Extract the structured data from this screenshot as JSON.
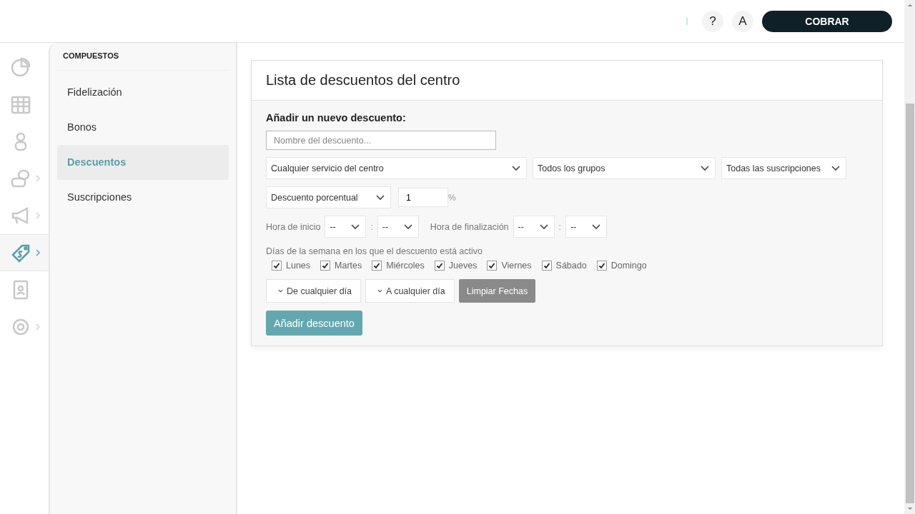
{
  "header": {
    "help": "?",
    "avatar": "A",
    "charge_button": "COBRAR"
  },
  "rail": [
    {
      "kind": "pie",
      "selected": false,
      "submenu": false
    },
    {
      "kind": "calendar",
      "selected": false,
      "submenu": false
    },
    {
      "kind": "person",
      "selected": false,
      "submenu": false
    },
    {
      "kind": "coins",
      "selected": false,
      "submenu": true
    },
    {
      "kind": "megaphone",
      "selected": false,
      "submenu": true
    },
    {
      "kind": "tag",
      "selected": true,
      "submenu": true
    },
    {
      "kind": "badge",
      "selected": false,
      "submenu": false
    },
    {
      "kind": "gear",
      "selected": false,
      "submenu": true
    }
  ],
  "submenu": {
    "heading": "COMPUESTOS",
    "items": [
      {
        "label": "Fidelización",
        "selected": false
      },
      {
        "label": "Bonos",
        "selected": false
      },
      {
        "label": "Descuentos",
        "selected": true
      },
      {
        "label": "Suscripciones",
        "selected": false
      }
    ]
  },
  "card": {
    "title": "Lista de descuentos del centro",
    "form": {
      "heading": "Añadir un nuevo descuento:",
      "name_field": {
        "placeholder": "Nombre del descuento..."
      },
      "filters": [
        "Cualquier servicio del centro",
        "Todos los grupos",
        "Todas las suscripciones"
      ],
      "discount_type": "Descuento porcentual",
      "amount": "1",
      "unit": "%",
      "start_label": "Hora de inicio",
      "start_hour": "--",
      "start_separator": ":",
      "start_minute": "--",
      "end_label": "Hora de finalización",
      "end_hour": "--",
      "end_separator": ":",
      "end_minute": "--",
      "days_label": "Días de la semana en los que el descuento está activo",
      "days": [
        {
          "label": "Lunes",
          "checked": true
        },
        {
          "label": "Martes",
          "checked": true
        },
        {
          "label": "Miércoles",
          "checked": true
        },
        {
          "label": "Jueves",
          "checked": true
        },
        {
          "label": "Viernes",
          "checked": true
        },
        {
          "label": "Sábado",
          "checked": true
        },
        {
          "label": "Domingo",
          "checked": true
        }
      ],
      "date_from": "De cualquier día",
      "date_to": "A cualquier día",
      "clear_button": "Limpiar Fechas",
      "submit_button": "Añadir descuento"
    }
  }
}
